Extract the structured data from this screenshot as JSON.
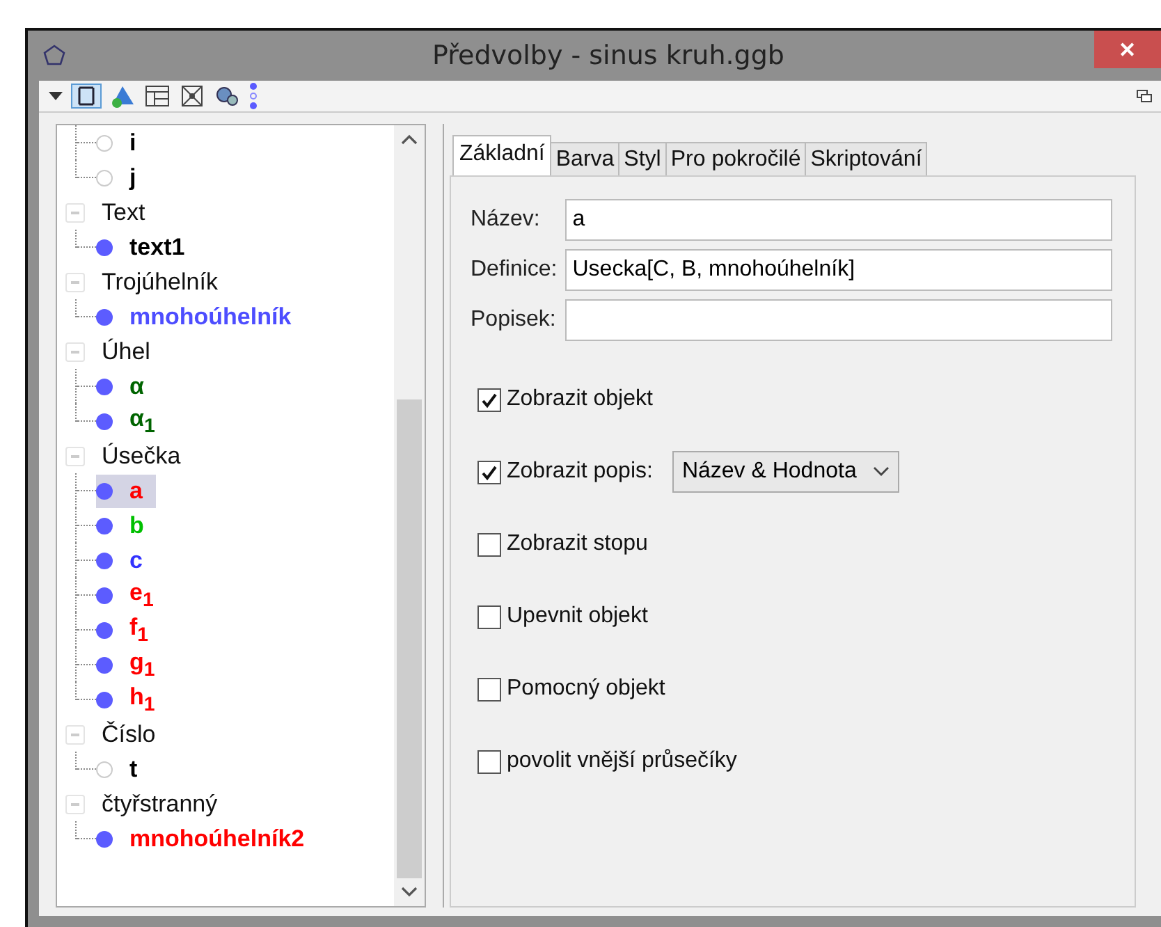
{
  "window": {
    "title": "Předvolby - sinus kruh.ggb",
    "close": "✕"
  },
  "tree": [
    {
      "children": [
        {
          "name": "i",
          "color": "#000000",
          "shown": false,
          "selected": false
        },
        {
          "name": "j",
          "color": "#000000",
          "shown": false,
          "selected": false
        }
      ]
    },
    {
      "label": "Text",
      "expanded": true,
      "children": [
        {
          "name": "text1",
          "color": "#000000",
          "shown": true,
          "selected": false
        }
      ]
    },
    {
      "label": "Trojúhelník",
      "expanded": true,
      "children": [
        {
          "name": "mnohoúhelník",
          "color": "#4d4dff",
          "shown": true,
          "selected": false
        }
      ]
    },
    {
      "label": "Úhel",
      "expanded": true,
      "children": [
        {
          "name": "α",
          "color": "#006400",
          "shown": true,
          "selected": false
        },
        {
          "name": "α$_{1}$",
          "color": "#006400",
          "shown": true,
          "selected": false
        }
      ]
    },
    {
      "label": "Úsečka",
      "expanded": true,
      "children": [
        {
          "name": "a",
          "color": "#ff0000",
          "shown": true,
          "selected": true
        },
        {
          "name": "b",
          "color": "#00c000",
          "shown": true,
          "selected": false
        },
        {
          "name": "c",
          "color": "#3333ff",
          "shown": true,
          "selected": false
        },
        {
          "name": "e$_{1}$",
          "color": "#ff0000",
          "shown": true,
          "selected": false
        },
        {
          "name": "f$_{1}$",
          "color": "#ff0000",
          "shown": true,
          "selected": false
        },
        {
          "name": "g$_{1}$",
          "color": "#ff0000",
          "shown": true,
          "selected": false
        },
        {
          "name": "h$_{1}$",
          "color": "#ff0000",
          "shown": true,
          "selected": false
        }
      ]
    },
    {
      "label": "Číslo",
      "expanded": true,
      "children": [
        {
          "name": "t",
          "color": "#000000",
          "shown": false,
          "selected": false
        }
      ]
    },
    {
      "label": "čtyřstranný",
      "expanded": true,
      "children": [
        {
          "name": "mnohoúhelník2",
          "color": "#ff0000",
          "shown": true,
          "selected": false
        }
      ]
    }
  ],
  "tabs": [
    {
      "label": "Základní",
      "selected": true
    },
    {
      "label": "Barva",
      "selected": false
    },
    {
      "label": "Styl",
      "selected": false
    },
    {
      "label": "Pro pokročilé",
      "selected": false
    },
    {
      "label": "Skriptování",
      "selected": false
    }
  ],
  "fields": [
    {
      "label": "Název:",
      "value": "a"
    },
    {
      "label": "Definice:",
      "value": "Usecka[C, B, mnohoúhelník]"
    },
    {
      "label": "Popisek:"
    }
  ],
  "options": [
    {
      "kind": "checkbox",
      "label": "Zobrazit objekt",
      "checked": true
    },
    {
      "kind": "checkbox-select",
      "label": "Zobrazit popis:",
      "checked": true,
      "select": "Název & Hodnota"
    },
    {
      "kind": "checkbox",
      "label": "Zobrazit stopu",
      "checked": false
    },
    {
      "kind": "checkbox",
      "label": "Upevnit objekt",
      "checked": false
    },
    {
      "kind": "checkbox",
      "label": "Pomocný objekt",
      "checked": false
    },
    {
      "kind": "checkbox",
      "label": "povolit vnější průsečíky",
      "checked": false
    }
  ]
}
